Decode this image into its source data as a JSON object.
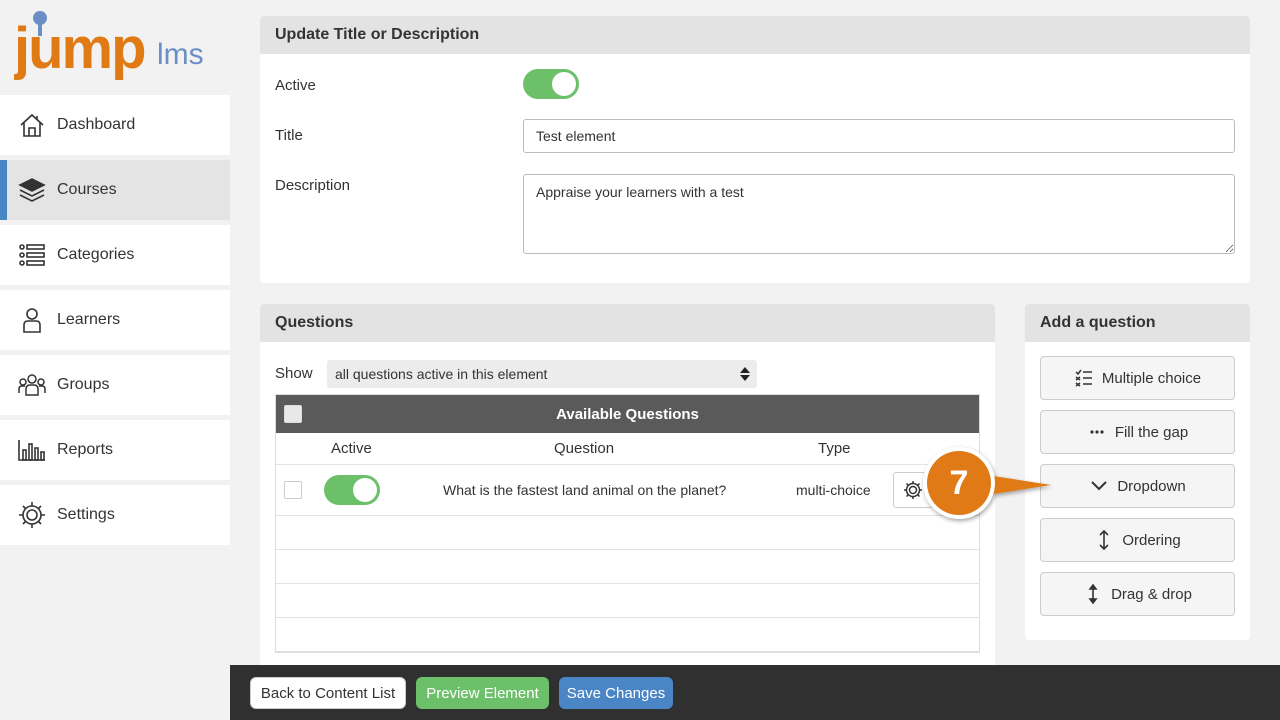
{
  "sidebar": {
    "logo_text": "jumplms",
    "items": [
      {
        "label": "Dashboard",
        "icon": "home-icon",
        "active": false
      },
      {
        "label": "Courses",
        "icon": "books-icon",
        "active": true
      },
      {
        "label": "Categories",
        "icon": "list-icon",
        "active": false
      },
      {
        "label": "Learners",
        "icon": "person-icon",
        "active": false
      },
      {
        "label": "Groups",
        "icon": "group-icon",
        "active": false
      },
      {
        "label": "Reports",
        "icon": "bar-chart-icon",
        "active": false
      },
      {
        "label": "Settings",
        "icon": "gear-icon",
        "active": false
      }
    ]
  },
  "update_panel": {
    "header": "Update Title or Description",
    "active_label": "Active",
    "active_on": true,
    "title_label": "Title",
    "title_value": "Test element",
    "description_label": "Description",
    "description_value": "Appraise your learners with a test"
  },
  "questions_panel": {
    "header": "Questions",
    "show_label": "Show",
    "show_value": "all questions active in this element",
    "table_title": "Available Questions",
    "columns": [
      "Active",
      "Question",
      "Type"
    ],
    "rows": [
      {
        "active": true,
        "question": "What is the fastest land animal on the planet?",
        "type": "multi-choice"
      }
    ]
  },
  "add_panel": {
    "header": "Add a question",
    "buttons": [
      {
        "label": "Multiple choice",
        "icon": "checklist-icon"
      },
      {
        "label": "Fill the gap",
        "icon": "ellipsis-icon"
      },
      {
        "label": "Dropdown",
        "icon": "chevron-down-icon"
      },
      {
        "label": "Ordering",
        "icon": "vertical-arrows-icon"
      },
      {
        "label": "Drag & drop",
        "icon": "drag-arrows-icon"
      }
    ]
  },
  "footer": {
    "back_label": "Back to Content List",
    "preview_label": "Preview Element",
    "save_label": "Save Changes"
  },
  "callout": {
    "number": "7",
    "color": "#e07a14"
  },
  "colors": {
    "accent_blue": "#4a86c5",
    "toggle_green": "#6cc06a",
    "logo_orange": "#e07a14",
    "preview_green": "#6cc06a",
    "save_blue": "#4a86c5"
  }
}
